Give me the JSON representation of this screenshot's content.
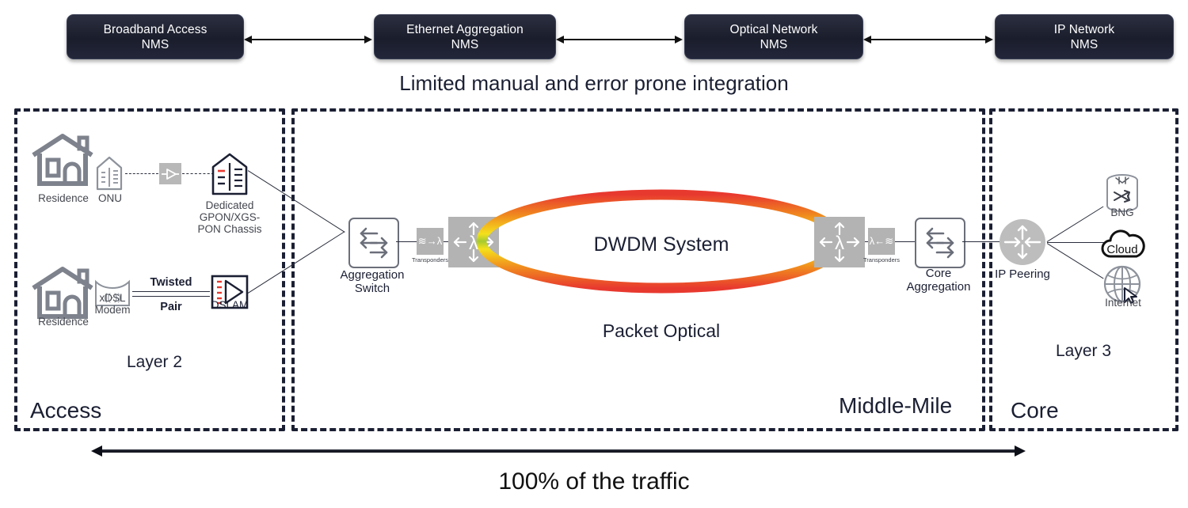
{
  "top_row": {
    "nms_boxes": [
      {
        "line1": "Broadband Access",
        "line2": "NMS"
      },
      {
        "line1": "Ethernet Aggregation",
        "line2": "NMS"
      },
      {
        "line1": "Optical Network",
        "line2": "NMS"
      },
      {
        "line1": "IP Network",
        "line2": "NMS"
      }
    ],
    "caption": "Limited manual and error prone integration"
  },
  "sections": {
    "access": {
      "name": "Access",
      "layer": "Layer 2"
    },
    "middle": {
      "name": "Middle-Mile"
    },
    "core": {
      "name": "Core",
      "layer": "Layer 3"
    }
  },
  "access_nodes": {
    "residence_top": "Residence",
    "onu": "ONU",
    "chassis": "Dedicated GPON/XGS-PON Chassis",
    "residence_bottom": "Residence",
    "xdsl_modem": "xDSL Modem",
    "twisted": "Twisted",
    "pair": "Pair",
    "dslam": "DSLAM"
  },
  "middle_nodes": {
    "aggregation_switch": "Aggregation Switch",
    "transponder_left": "Transponders",
    "transponder_left_glyph": "≋→λ",
    "roadm_glyph": "λ",
    "dwdm_title": "DWDM System",
    "packet_optical": "Packet Optical",
    "transponder_right": "Transponders",
    "transponder_right_glyph": "λ←≋",
    "core_aggregation": "Core Aggregation"
  },
  "core_nodes": {
    "ip_peering": "IP Peering",
    "bng": "BNG",
    "cloud": "Cloud",
    "internet": "Internet"
  },
  "footer": {
    "traffic_label": "100% of the traffic"
  },
  "colors": {
    "nms_box": "#1a1d2b",
    "frame_dash": "#1b1f33",
    "grey_node": "#b3b3b3",
    "accent_red": "#e8392f",
    "rainbow_outer": "#e8392f",
    "rainbow_inner": "#1d6fd0"
  }
}
